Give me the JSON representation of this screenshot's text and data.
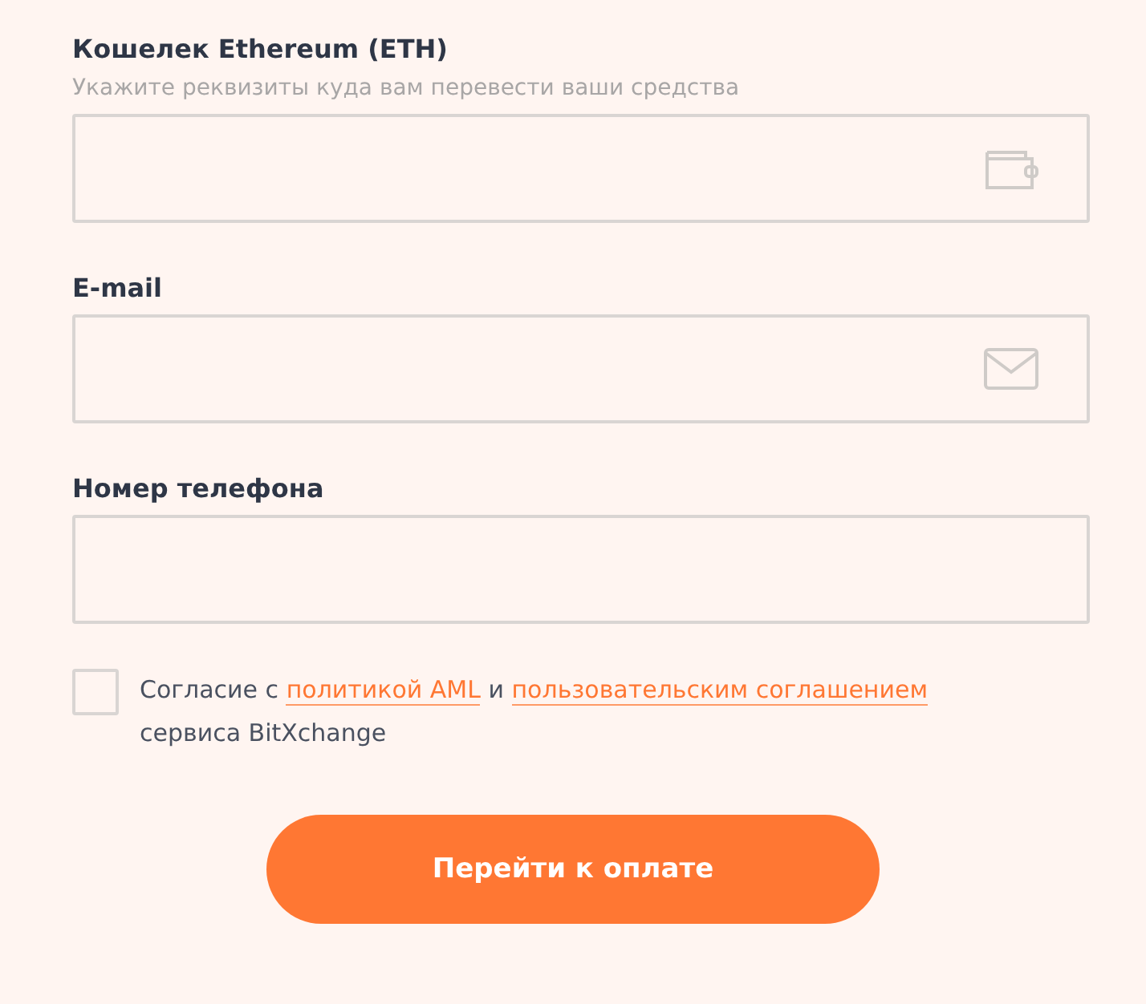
{
  "fields": [
    {
      "label": "Кошелек Ethereum (ETH)",
      "hint": "Укажите реквизиты куда вам перевести ваши средства",
      "kind": "wallet"
    },
    {
      "label": "E-mail",
      "kind": "email"
    },
    {
      "label": "Номер телефона",
      "kind": "phone"
    }
  ],
  "agreement": {
    "checked": false,
    "parts": [
      {
        "kind": "text",
        "text": "Согласие с "
      },
      {
        "kind": "link",
        "text": "политикой AML"
      },
      {
        "kind": "text",
        "text": " и "
      },
      {
        "kind": "link",
        "text": "пользовательским соглашением"
      },
      {
        "kind": "text",
        "text": " сервиса BitXchange"
      }
    ]
  },
  "submit": "Перейти к оплате"
}
